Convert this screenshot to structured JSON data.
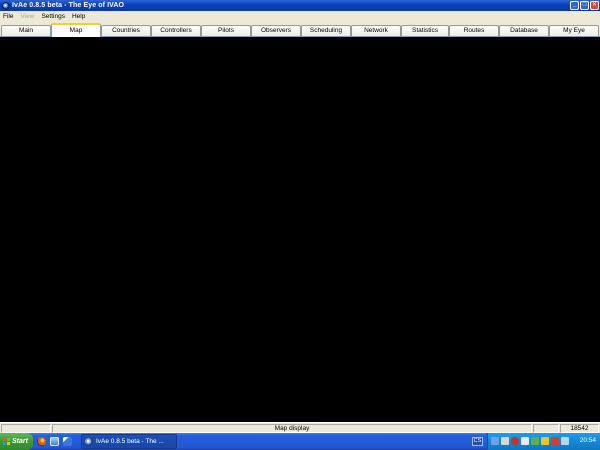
{
  "window": {
    "title": "IvAe 0.8.5 beta - The Eye of IVAO",
    "buttons": [
      "_",
      "□",
      "×"
    ]
  },
  "menu": {
    "items": [
      {
        "label": "File",
        "enabled": true
      },
      {
        "label": "View",
        "enabled": false
      },
      {
        "label": "Settings",
        "enabled": true
      },
      {
        "label": "Help",
        "enabled": true
      }
    ]
  },
  "tabs": {
    "active": "Map",
    "items": [
      "Main",
      "Map",
      "Countries",
      "Controllers",
      "Pilots",
      "Observers",
      "Scheduling",
      "Network",
      "Statistics",
      "Routes",
      "Database",
      "My Eye"
    ]
  },
  "status": {
    "message": "Map display",
    "counter": "18542"
  },
  "taskbar": {
    "start_label": "Start",
    "task_label": "IvAe 0.8.5 beta - The ...",
    "language": "CS",
    "clock": "20:54"
  },
  "colors": {
    "titlebar": "#0a3fb8",
    "map_background": "#000000",
    "taskbar": "#245edc",
    "start_button": "#3c9a36"
  }
}
